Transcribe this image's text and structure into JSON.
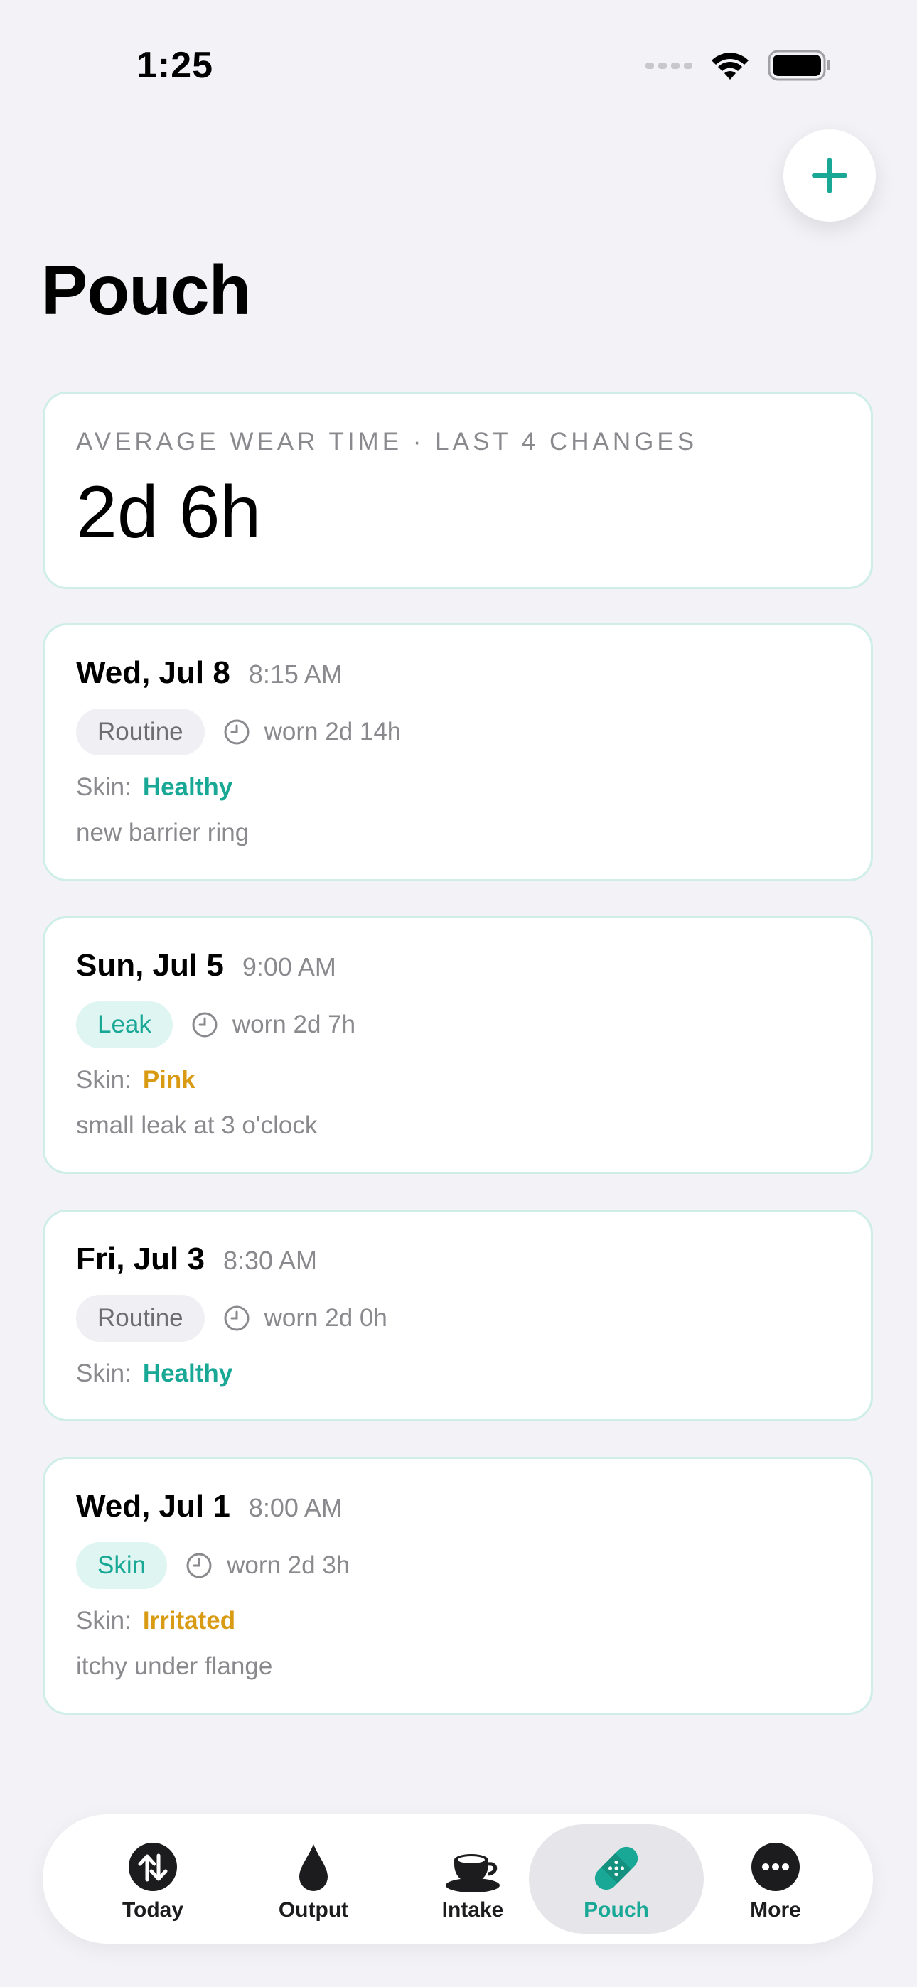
{
  "status": {
    "time": "1:25"
  },
  "page": {
    "title": "Pouch"
  },
  "summary": {
    "label": "AVERAGE WEAR TIME · LAST 4 CHANGES",
    "value": "2d 6h"
  },
  "changes": [
    {
      "date": "Wed, Jul 8",
      "time": "8:15 AM",
      "tag": "Routine",
      "worn": "worn 2d 14h",
      "skin_label": "Skin:",
      "skin": "Healthy",
      "note": "new barrier ring"
    },
    {
      "date": "Sun, Jul 5",
      "time": "9:00 AM",
      "tag": "Leak",
      "worn": "worn 2d 7h",
      "skin_label": "Skin:",
      "skin": "Pink",
      "note": "small leak at 3 o'clock"
    },
    {
      "date": "Fri, Jul 3",
      "time": "8:30 AM",
      "tag": "Routine",
      "worn": "worn 2d 0h",
      "skin_label": "Skin:",
      "skin": "Healthy",
      "note": ""
    },
    {
      "date": "Wed, Jul 1",
      "time": "8:00 AM",
      "tag": "Skin",
      "worn": "worn 2d 3h",
      "skin_label": "Skin:",
      "skin": "Irritated",
      "note": "itchy under flange"
    }
  ],
  "tabs": [
    {
      "label": "Today",
      "icon": "arrows-updown-icon"
    },
    {
      "label": "Output",
      "icon": "drop-icon"
    },
    {
      "label": "Intake",
      "icon": "cup-icon"
    },
    {
      "label": "Pouch",
      "icon": "bandage-icon",
      "active": true
    },
    {
      "label": "More",
      "icon": "ellipsis-icon"
    }
  ],
  "colors": {
    "accent": "#19a896",
    "warning": "#d99a14",
    "background": "#f2f2f7",
    "card_border": "#cfeee8"
  }
}
